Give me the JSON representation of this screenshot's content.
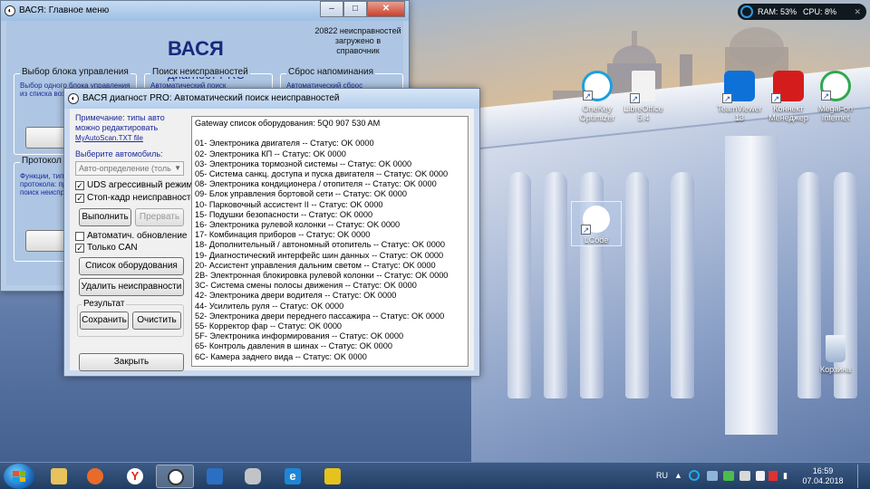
{
  "main_window": {
    "title": "ВАСЯ:  Главное меню",
    "brand": "ВАСЯ",
    "brand_sub": "диагност PRO",
    "fault_count_line1": "20822 неисправностей",
    "fault_count_line2": "загружено в справочник",
    "groups": [
      {
        "title": "Выбор блока управления",
        "text1": "Выбор одного блока управления",
        "text2": "из списка возм"
      },
      {
        "title": "Поиск неисправностей",
        "text1": "Автоматический поиск",
        "text2": ""
      },
      {
        "title": "Сброс напоминания",
        "text1": "Автоматический сброс",
        "text2": ""
      },
      {
        "title": "Протокол О",
        "text1": "Функции, типи",
        "text2": "протокола: пр",
        "text3": "поиск неиспр"
      }
    ]
  },
  "dialog": {
    "title": "ВАСЯ диагност PRO:  Автоматический поиск неисправностей",
    "note_line1": "Примечание: типы авто",
    "note_line2": "можно редактировать",
    "note_link": "MyAutoScan.TXT file",
    "select_label": "Выберите автомобиль:",
    "car_combo_value": "Авто-определение (толь",
    "chk_uds": "UDS агрессивный режим",
    "chk_freeze": "Стоп-кадр неисправностей",
    "btn_run": "Выполнить",
    "btn_abort": "Прервать",
    "chk_auto_update": "Автоматич. обновление",
    "chk_can_only": "Только CAN",
    "btn_equipment_list": "Список оборудования",
    "btn_delete_faults": "Удалить неисправности",
    "result_group": "Результат",
    "btn_save": "Сохранить",
    "btn_clear": "Очистить",
    "btn_close": "Закрыть",
    "output_header": "Gateway список оборудования:  5Q0 907 530 AM",
    "output_lines": [
      "01- Электроника двигателя -- Статус: OK 0000",
      "02- Электроника КП -- Статус: OK 0000",
      "03- Электроника тормозной системы -- Статус: OK 0000",
      "05- Система санкц. доступа и пуска двигателя -- Статус: OK 0000",
      "08- Электроника кондиционера / отопителя -- Статус: OK 0000",
      "09- Блок управления бортовой сети -- Статус: OK 0000",
      "10- Парковочный ассистент II -- Статус: OK 0000",
      "15- Подушки безопасности -- Статус: OK 0000",
      "16- Электроника рулевой колонки -- Статус: OK 0000",
      "17- Комбинация приборов -- Статус: OK 0000",
      "18- Дополнительный / автономный отопитель -- Статус: OK 0000",
      "19- Диагностический интерфейс шин данных -- Статус: OK 0000",
      "20- Ассистент управления дальним светом -- Статус: OK 0000",
      "2B- Электронная блокировка рулевой колонки -- Статус: OK 0000",
      "3C- Система смены полосы движения -- Статус: OK 0000",
      "42- Электроника двери водителя -- Статус: OK 0000",
      "44- Усилитель руля -- Статус: OK 0000",
      "52- Электроника двери переднего пассажира -- Статус: OK 0000",
      "55- Корректор фар -- Статус: OK 0000",
      "5F- Электроника информирования -- Статус: OK 0000",
      "65- Контроль давления в шинах -- Статус: OK 0000",
      "6C- Камера заднего вида -- Статус: OK 0000"
    ]
  },
  "desktop_icons": {
    "onekey1": "OneKey",
    "onekey2": "Optimizer",
    "libre1": "LibreOffice",
    "libre2": "5.4",
    "team1": "TeamViewer",
    "team2": "13",
    "konnekt1": "Коннект",
    "konnekt2": "Менеджер",
    "mega1": "MegaFon",
    "mega2": "Internet",
    "lcode": "LCode",
    "recycle": "Корзина"
  },
  "gadget": {
    "ram": "RAM: 53%",
    "cpu": "CPU: 8%"
  },
  "taskbar": {
    "lang": "RU",
    "time": "16:59",
    "date": "07.04.2018"
  }
}
